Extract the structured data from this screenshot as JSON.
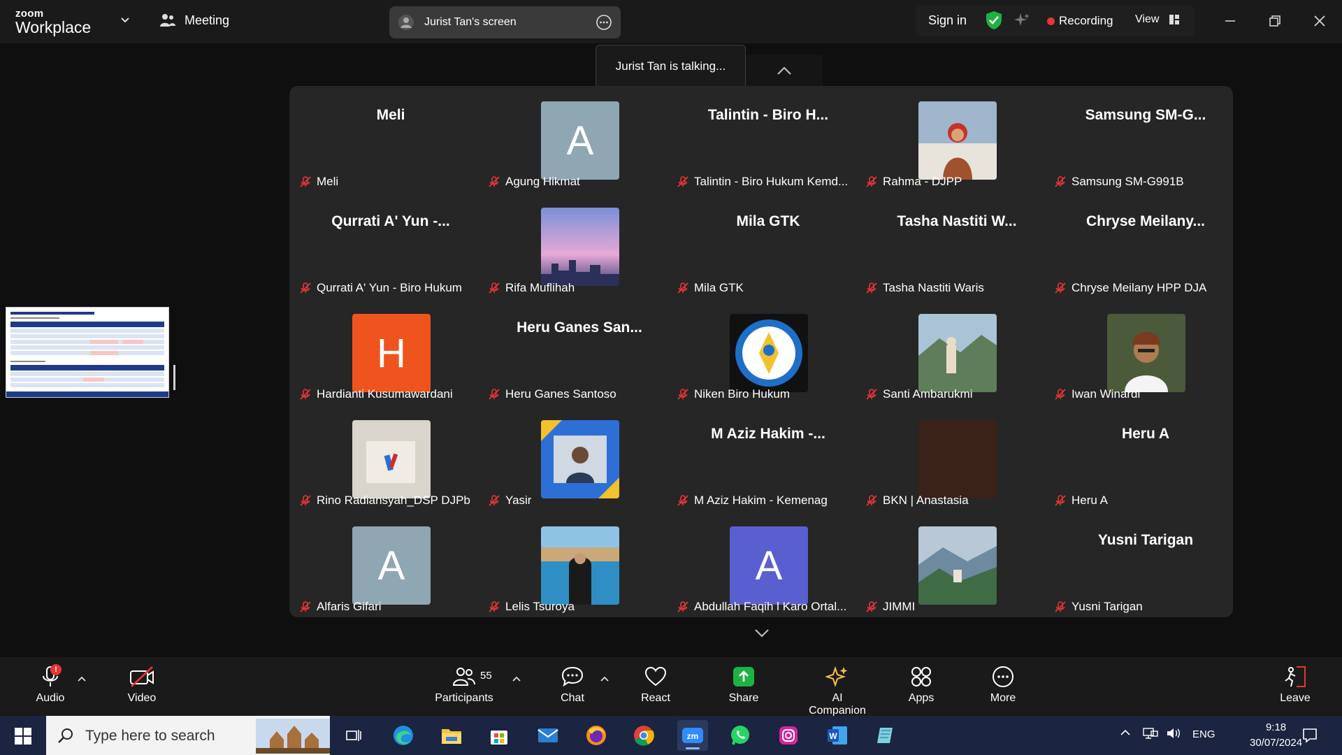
{
  "app": {
    "brand_small": "zoom",
    "brand_large": "Workplace",
    "meeting_label": "Meeting"
  },
  "screen_share": {
    "label": "Jurist Tan's screen"
  },
  "topbar": {
    "sign_in": "Sign in",
    "recording": "Recording",
    "view": "View"
  },
  "talking": "Jurist Tan is talking...",
  "participants": [
    {
      "caption": "Meli",
      "card": "Meli",
      "type": "text"
    },
    {
      "caption": "Agung Hikmat",
      "type": "letter",
      "letter": "A",
      "color": "#8fa6b3"
    },
    {
      "caption": "Talintin - Biro Hukum Kemd...",
      "card": "Talintin - Biro H...",
      "type": "text"
    },
    {
      "caption": "Rahma - DJPP",
      "type": "photo",
      "photo": "photo-rahma"
    },
    {
      "caption": "Samsung SM-G991B",
      "card": "Samsung SM-G...",
      "type": "text"
    },
    {
      "caption": "Qurrati A' Yun - Biro Hukum",
      "card": "Qurrati A' Yun -...",
      "type": "text"
    },
    {
      "caption": "Rifa Muflihah",
      "type": "photo",
      "photo": "photo-rifa"
    },
    {
      "caption": "Mila GTK",
      "card": "Mila GTK",
      "type": "text"
    },
    {
      "caption": "Tasha Nastiti Waris",
      "card": "Tasha Nastiti W...",
      "type": "text"
    },
    {
      "caption": "Chryse Meilany HPP DJA",
      "card": "Chryse  Meilany...",
      "type": "text"
    },
    {
      "caption": "Hardianti Kusumawardani",
      "type": "letter",
      "letter": "H",
      "color": "#f0541e"
    },
    {
      "caption": "Heru Ganes Santoso",
      "card": "Heru Ganes San...",
      "type": "text"
    },
    {
      "caption": "Niken Biro Hukum",
      "type": "photo",
      "photo": "photo-niken"
    },
    {
      "caption": "Santi Ambarukmi",
      "type": "photo",
      "photo": "photo-santi"
    },
    {
      "caption": "Iwan Winardi",
      "type": "photo",
      "photo": "photo-iwan"
    },
    {
      "caption": "Rino Radiansyah_DSP DJPb",
      "type": "photo",
      "photo": "photo-rino"
    },
    {
      "caption": "Yasir",
      "type": "photo",
      "photo": "photo-yasir"
    },
    {
      "caption": "M Aziz Hakim - Kemenag",
      "card": "M Aziz Hakim -...",
      "type": "text"
    },
    {
      "caption": "BKN | Anastasia",
      "type": "photo",
      "photo": "photo-bkn"
    },
    {
      "caption": "Heru A",
      "card": "Heru A",
      "type": "text"
    },
    {
      "caption": "Alfaris Gifari",
      "type": "letter",
      "letter": "A",
      "color": "#8fa6b3"
    },
    {
      "caption": "Lelis Tsuroya",
      "type": "photo",
      "photo": "photo-lelis"
    },
    {
      "caption": "Abdullah Faqih l Karo Ortal...",
      "type": "letter",
      "letter": "A",
      "color": "#5a5fd0"
    },
    {
      "caption": "JIMMI",
      "type": "photo",
      "photo": "photo-jimmi"
    },
    {
      "caption": "Yusni Tarigan",
      "card": "Yusni Tarigan",
      "type": "text"
    }
  ],
  "toolbar": {
    "audio": "Audio",
    "audio_badge": "!",
    "video": "Video",
    "participants": "Participants",
    "participants_count": "55",
    "chat": "Chat",
    "react": "React",
    "share": "Share",
    "ai_companion": "AI Companion",
    "apps": "Apps",
    "more": "More",
    "leave": "Leave"
  },
  "taskbar": {
    "search_placeholder": "Type here to search",
    "lang": "ENG",
    "time": "9:18",
    "date": "30/07/2024"
  },
  "colors": {
    "accent_green": "#1fb141",
    "recording_red": "#e8343a",
    "mute_red": "#e8343a"
  }
}
